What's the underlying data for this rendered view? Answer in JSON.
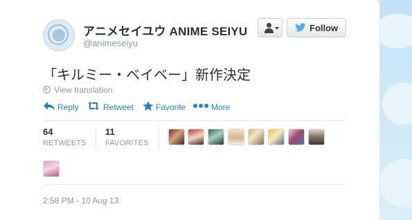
{
  "user": {
    "display_name": "アニメセイユウ ANIME SEIYU",
    "handle": "@animeseiyu"
  },
  "buttons": {
    "user_actions_icon": "user-icon",
    "follow_label": "Follow"
  },
  "tweet": {
    "text": "「キルミー・ベイベー」新作決定",
    "view_translation": "View translation",
    "timestamp": "2:58 PM - 10 Aug 13"
  },
  "actions": {
    "reply": "Reply",
    "retweet": "Retweet",
    "favorite": "Favorite",
    "more": "More"
  },
  "stats": {
    "retweets_count": "64",
    "retweets_label": "RETWEETS",
    "favorites_count": "11",
    "favorites_label": "FAVORITES"
  },
  "colors": {
    "link_blue": "#2a7fc1",
    "text_dark": "#292f33",
    "text_muted": "#8899a6",
    "twitter_bird": "#55acee"
  },
  "favoriters_avatars": [
    "favoriter-avatar-1",
    "favoriter-avatar-2",
    "favoriter-avatar-3",
    "favoriter-avatar-4",
    "favoriter-avatar-5",
    "favoriter-avatar-6",
    "favoriter-avatar-7",
    "favoriter-avatar-8",
    "favoriter-avatar-9"
  ]
}
